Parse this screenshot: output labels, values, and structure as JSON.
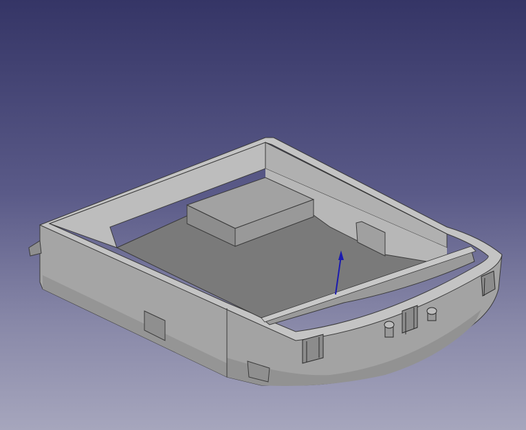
{
  "viewport": {
    "background_top": "#353566",
    "background_bottom": "#a6a6bd"
  },
  "model": {
    "body_color": "#a8a8a8",
    "floor_color": "#7a7a7a",
    "rim_color": "#c6c6c6"
  },
  "axis_indicator": {
    "icon": "z-axis-arrow-icon",
    "color": "#1a1ab0"
  }
}
